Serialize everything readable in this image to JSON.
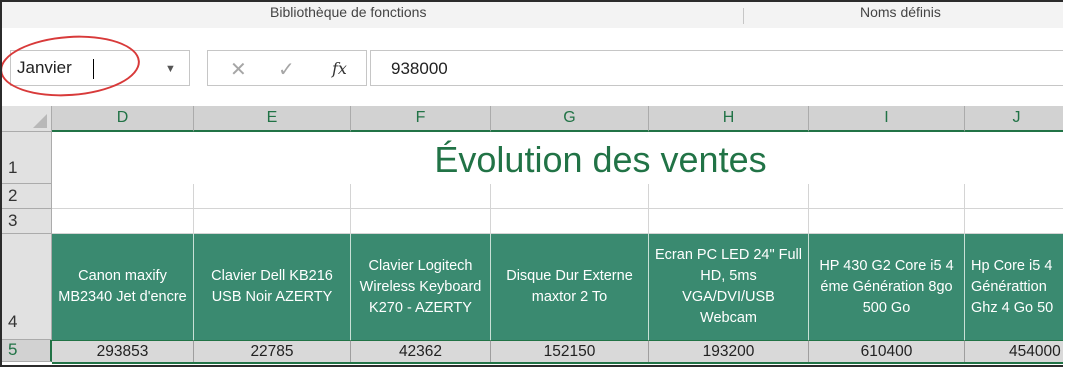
{
  "ribbon": {
    "group_functions": "Bibliothèque de fonctions",
    "group_names": "Noms définis"
  },
  "formula_bar": {
    "name_box": "Janvier",
    "cancel_icon": "cancel-icon",
    "enter_icon": "check-icon",
    "fx_label": "fx",
    "formula_value": "938000"
  },
  "columns": [
    "D",
    "E",
    "F",
    "G",
    "H",
    "I",
    "J"
  ],
  "rows": [
    "1",
    "2",
    "3",
    "4",
    "5"
  ],
  "sheet": {
    "title": "Évolution des ventes",
    "headers": [
      "Canon maxify MB2340 Jet d'encre",
      "Clavier Dell KB216 USB Noir AZERTY",
      "Clavier Logitech Wireless Keyboard K270 - AZERTY",
      "Disque Dur Externe maxtor 2 To",
      "Ecran PC LED 24\" Full HD, 5ms VGA/DVI/USB Webcam",
      "HP 430 G2 Core i5 4 éme Génération 8go 500 Go",
      "Hp Core i5 4 Générattion Ghz 4 Go 50"
    ],
    "values": [
      "293853",
      "22785",
      "42362",
      "152150",
      "193200",
      "610400",
      "454000"
    ]
  },
  "colors": {
    "accent": "#217346",
    "header_fill": "#3a8a70",
    "annotation": "#d83a3a"
  }
}
